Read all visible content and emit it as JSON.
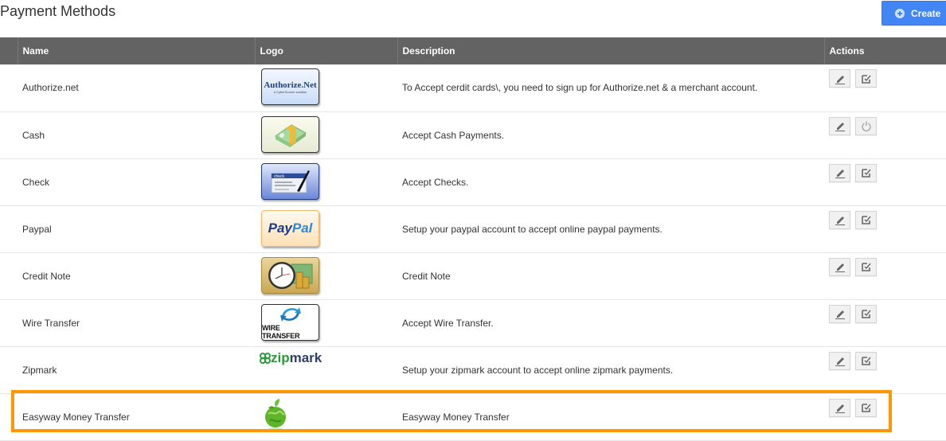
{
  "page": {
    "title": "Payment Methods",
    "create_label": "Create"
  },
  "table": {
    "columns": [
      "",
      "Name",
      "Logo",
      "Description",
      "Actions"
    ],
    "rows": [
      {
        "name": "Authorize.net",
        "logo": "authorize-net-logo",
        "logo_text": "Authorize.Net",
        "logo_subtext": "a CyberSource solution",
        "description": "To Accept cerdit cards\\, you need to sign up for Authorize.net & a merchant account.",
        "actions": [
          "edit",
          "enable-toggle"
        ]
      },
      {
        "name": "Cash",
        "logo": "cash-logo",
        "description": "Accept Cash Payments.",
        "actions": [
          "edit",
          "power"
        ]
      },
      {
        "name": "Check",
        "logo": "check-logo",
        "logo_text": "check",
        "description": "Accept Checks.",
        "actions": [
          "edit",
          "enable-toggle"
        ]
      },
      {
        "name": "Paypal",
        "logo": "paypal-logo",
        "logo_text_1": "Pay",
        "logo_text_2": "Pal",
        "description": "Setup your paypal account to accept online paypal payments.",
        "actions": [
          "edit",
          "enable-toggle"
        ]
      },
      {
        "name": "Credit Note",
        "logo": "credit-note-logo",
        "description": "Credit Note",
        "actions": [
          "edit",
          "enable-toggle"
        ]
      },
      {
        "name": "Wire Transfer",
        "logo": "wire-transfer-logo",
        "logo_text": "WIRE TRANSFER",
        "description": "Accept Wire Transfer.",
        "actions": [
          "edit",
          "enable-toggle"
        ]
      },
      {
        "name": "Zipmark",
        "logo": "zipmark-logo",
        "logo_text_1": "zip",
        "logo_text_2": "mark",
        "description": "Setup your zipmark account to accept online zipmark payments.",
        "actions": [
          "edit",
          "enable-toggle"
        ]
      },
      {
        "name": "Easyway Money Transfer",
        "logo": "easyway-logo",
        "description": "Easyway Money Transfer",
        "actions": [
          "edit",
          "enable-toggle"
        ],
        "highlighted": true
      }
    ]
  },
  "colors": {
    "header_bg": "#636363",
    "create_button": "#4285f4",
    "highlight": "#ff9800"
  }
}
